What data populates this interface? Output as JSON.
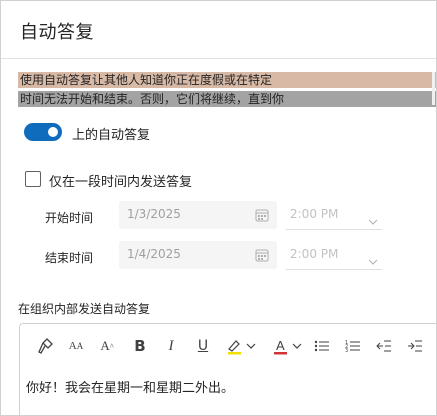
{
  "dialog": {
    "title": "自动答复"
  },
  "description": {
    "line1": "使用自动答复让其他人知道你正在度假或在特定",
    "line2": "时间无法开始和结束。否则，它们将继续，直到你"
  },
  "toggle": {
    "label": "上的自动答复",
    "on": true,
    "accent": "#0f6cbd"
  },
  "time_range": {
    "checkbox_label": "仅在一段时间内发送答复",
    "checked": false,
    "start_label": "开始时间",
    "start_date": "1/3/2025",
    "start_time": "2:00 PM",
    "end_label": "结束时间",
    "end_date": "1/4/2025",
    "end_time": "2:00 PM"
  },
  "inside_org": {
    "label": "在组织内部发送自动答复",
    "toolbar_icons": [
      "format-painter-icon",
      "font-size-icon",
      "grow-font-icon",
      "bold-icon",
      "italic-icon",
      "underline-icon",
      "highlight-icon",
      "font-color-icon",
      "bullets-icon",
      "numbering-icon",
      "decrease-indent-icon",
      "increase-indent-icon"
    ],
    "message": "你好！我会在星期一和星期二外出。"
  }
}
